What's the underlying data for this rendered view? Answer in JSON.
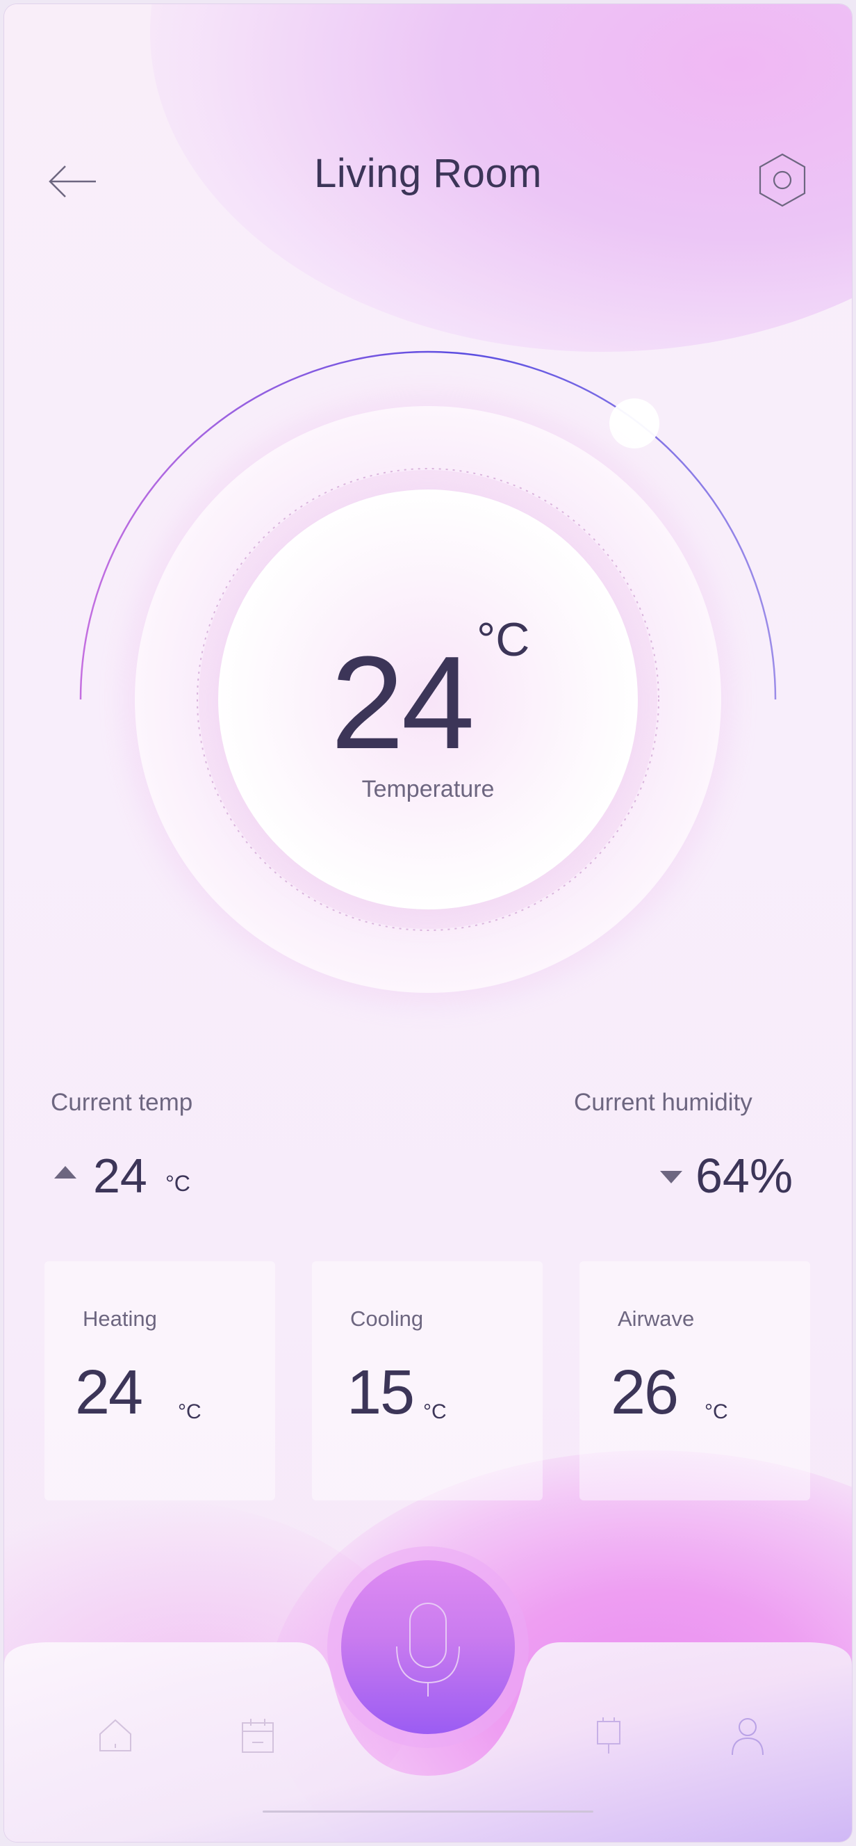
{
  "header": {
    "title": "Living Room",
    "back_icon": "arrow-left-icon",
    "settings_icon": "hexagon-settings-icon"
  },
  "dial": {
    "temperature": "24",
    "unit": "°C",
    "label": "Temperature",
    "arc_gradient": [
      "#c46fe0",
      "#5a4ce0",
      "#9b8ce8"
    ]
  },
  "stats": {
    "current_temp": {
      "label": "Current temp",
      "value": "24",
      "unit": "°C",
      "trend": "up"
    },
    "current_humidity": {
      "label": "Current humidity",
      "value": "64%",
      "trend": "down"
    }
  },
  "modes": [
    {
      "name": "Heating",
      "value": "24",
      "unit": "°C"
    },
    {
      "name": "Cooling",
      "value": "15",
      "unit": "°C"
    },
    {
      "name": "Airwave",
      "value": "26",
      "unit": "°C"
    }
  ],
  "tabbar": {
    "items": [
      "home-icon",
      "calendar-icon",
      "plug-icon",
      "profile-icon"
    ],
    "center": "microphone-icon"
  },
  "colors": {
    "text_primary": "#3c3558",
    "text_secondary": "#6d6680",
    "accent": "#9b5cf3"
  }
}
